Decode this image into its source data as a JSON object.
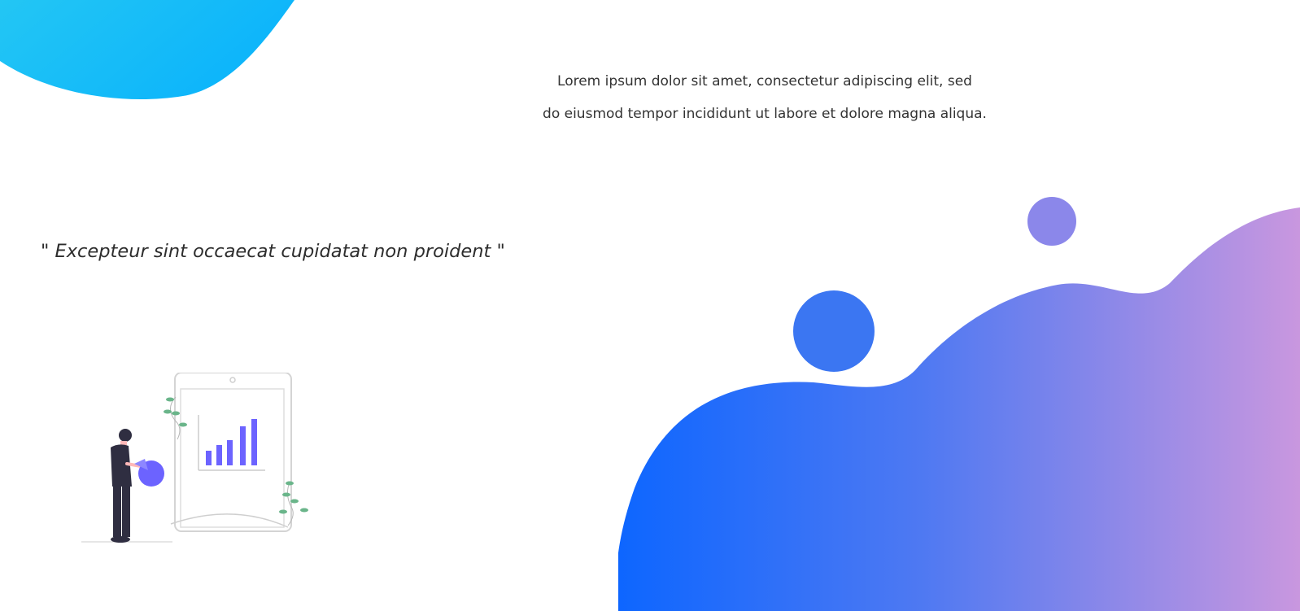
{
  "intro": {
    "line1": "Lorem ipsum dolor sit amet, consectetur adipiscing elit, sed",
    "line2": "do eiusmod tempor incididunt ut labore et dolore magna aliqua."
  },
  "quote": "\" Excepteur sint occaecat cupidatat non proident \"",
  "illustration": {
    "icon": "person-presenting-chart-icon"
  },
  "colors": {
    "top_blob": "#1ec2f4",
    "bottom_gradient_start": "#0d66ff",
    "bottom_gradient_end": "#c997df",
    "small_circle": "#8b87ea",
    "large_circle": "#3b76f2",
    "chart_bars": "#6c63ff",
    "plant": "#6ab58a",
    "person": "#2f2e41"
  }
}
